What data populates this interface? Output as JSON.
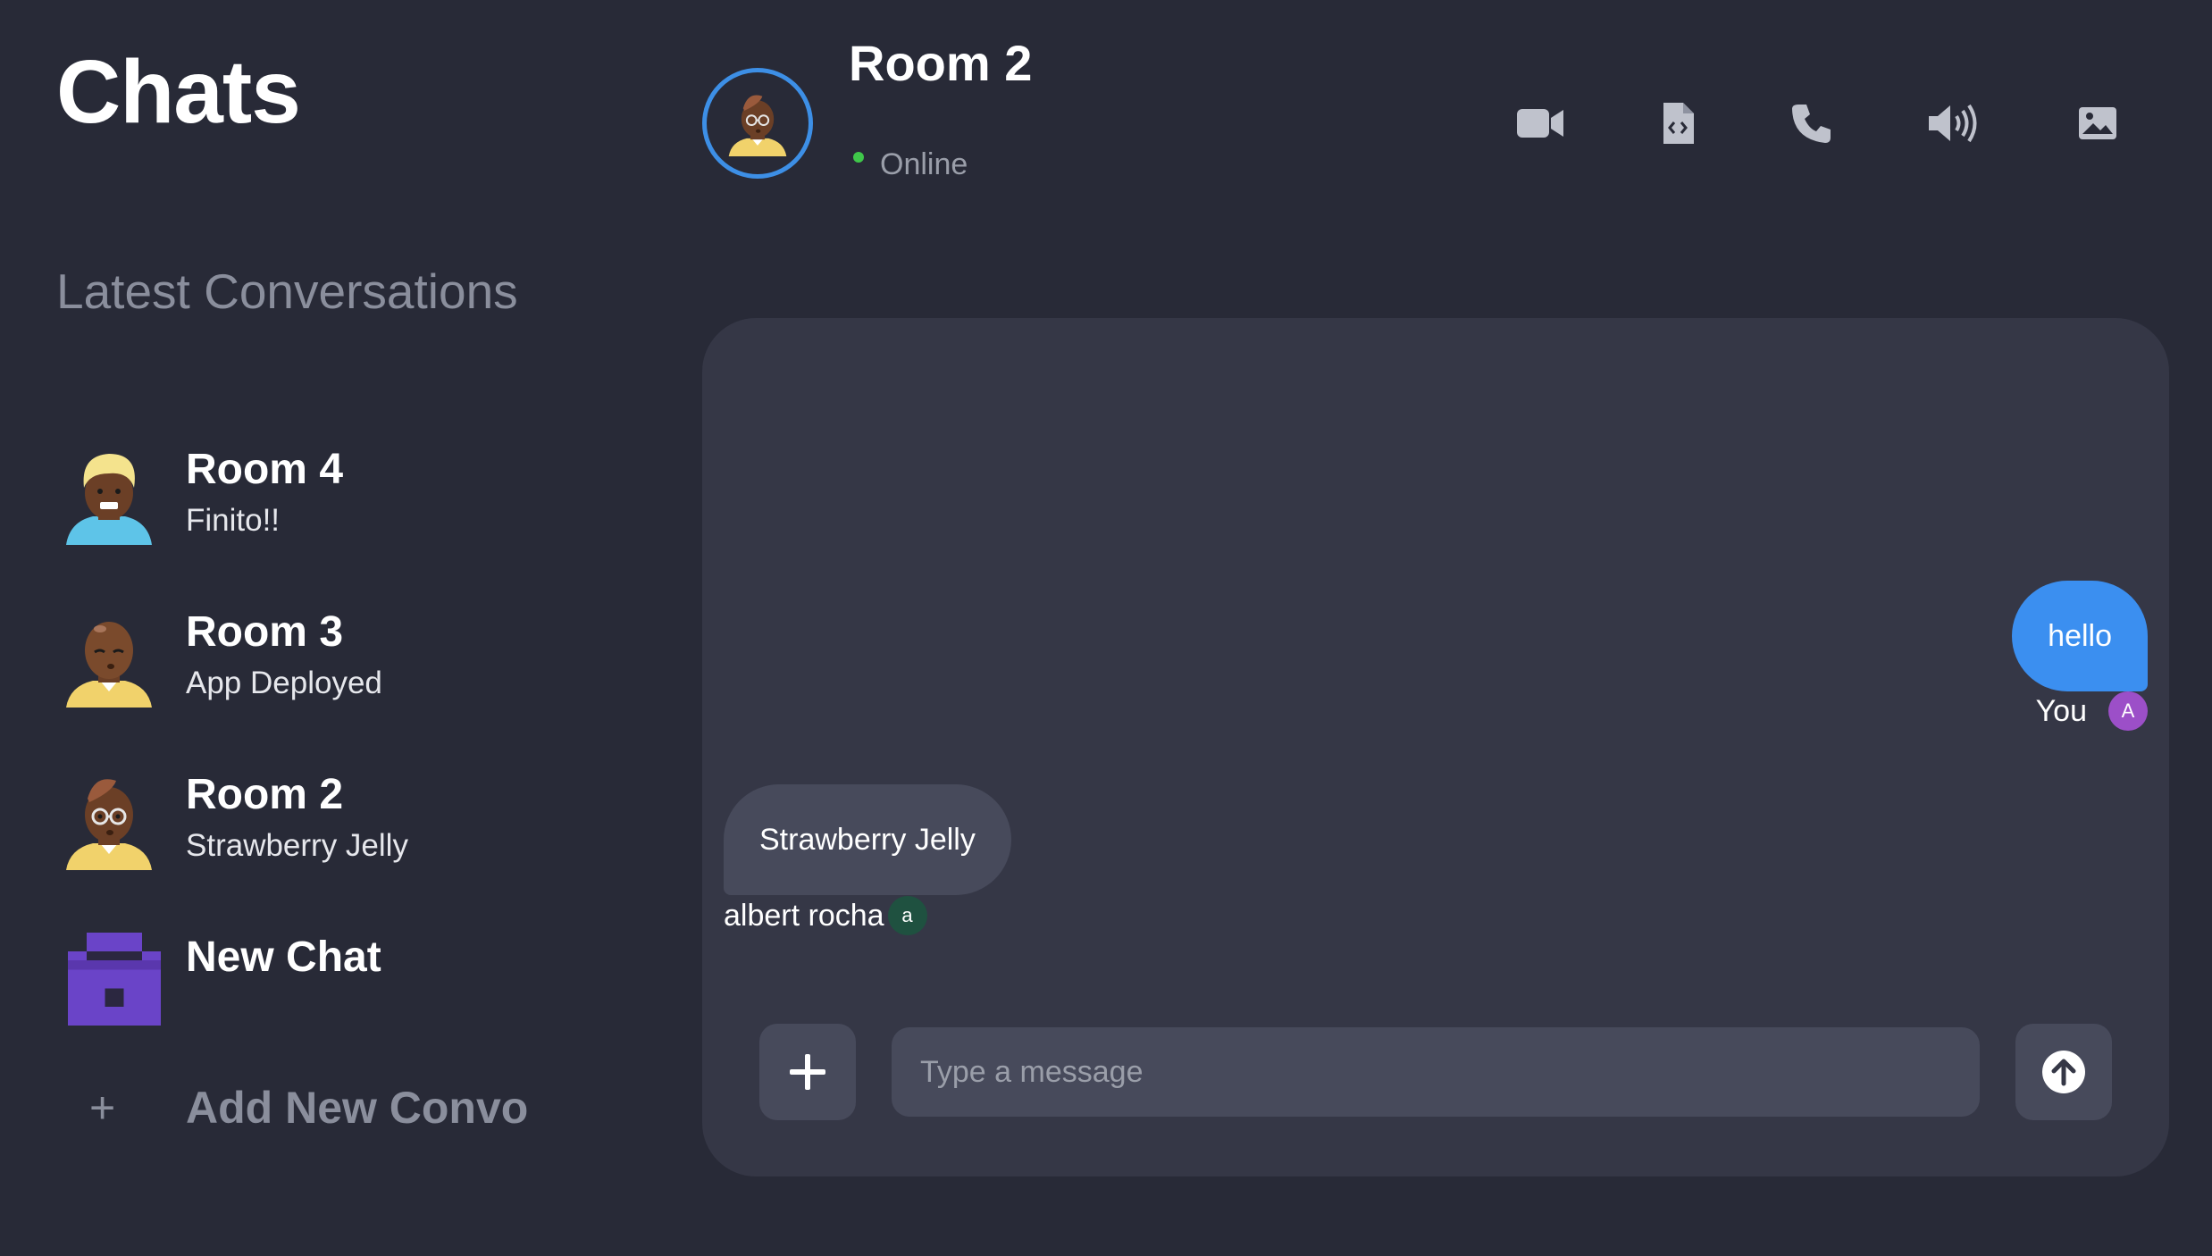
{
  "sidebar": {
    "title": "Chats",
    "section_title": "Latest Conversations",
    "conversations": [
      {
        "name": "Room 4",
        "preview": "Finito!!",
        "avatar": "avatar-blonde-icon"
      },
      {
        "name": "Room 3",
        "preview": "App Deployed",
        "avatar": "avatar-bald-icon"
      },
      {
        "name": "Room 2",
        "preview": "Strawberry Jelly",
        "avatar": "avatar-glasses-icon"
      },
      {
        "name": "New Chat",
        "preview": "",
        "avatar": "pixel-lock-icon"
      }
    ],
    "add_label": "Add New Convo",
    "add_icon": "+"
  },
  "header": {
    "room_title": "Room 2",
    "status": "Online",
    "status_color": "#3fc74a",
    "tools": [
      "video-icon",
      "file-code-icon",
      "phone-icon",
      "volume-icon",
      "image-icon"
    ]
  },
  "messages": [
    {
      "text": "hello",
      "sender": "You",
      "initial": "A",
      "direction": "outgoing",
      "badge_color": "#9c4fc8"
    },
    {
      "text": "Strawberry Jelly",
      "sender": "albert rocha",
      "initial": "a",
      "direction": "incoming",
      "badge_color": "#1f5140"
    }
  ],
  "composer": {
    "placeholder": "Type a message",
    "value": ""
  },
  "colors": {
    "background": "#282a37",
    "panel": "#353746",
    "accent": "#3b8ff0",
    "muted": "#8a8e9c"
  }
}
